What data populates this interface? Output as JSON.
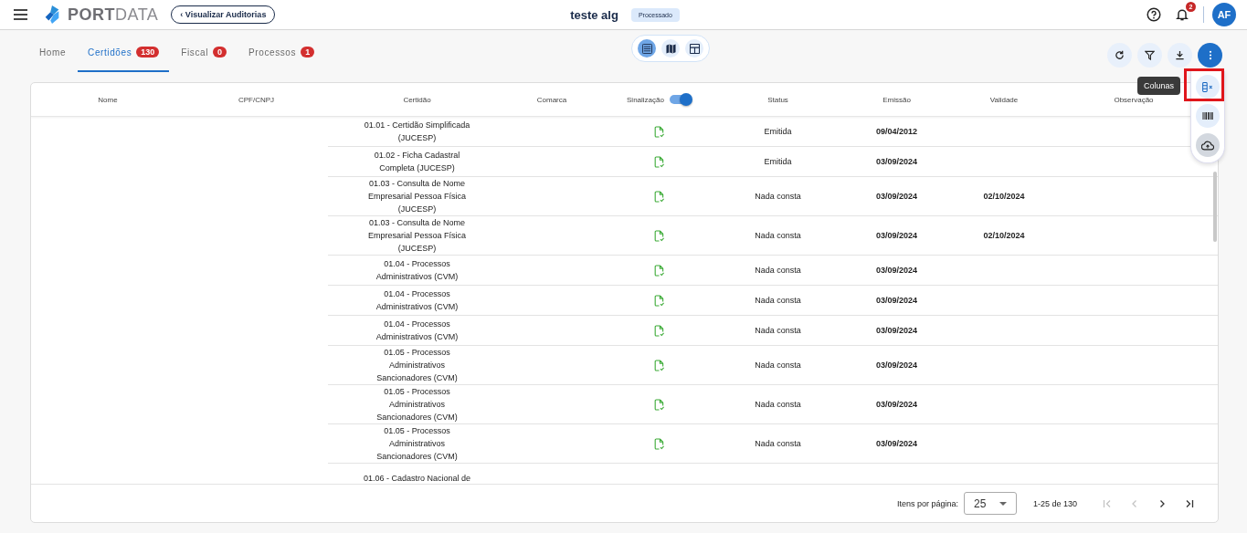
{
  "header": {
    "title": "teste alg",
    "status_badge": "Processado",
    "back_button": "Visualizar Auditorias",
    "back_chevron": "‹",
    "logo": {
      "part_1": "PORT",
      "part_2": "DATA"
    },
    "notifications": "2",
    "avatar": "AF"
  },
  "tabs": [
    {
      "label": "Home",
      "selected": false
    },
    {
      "label": "Certidões",
      "count": "130",
      "selected": true
    },
    {
      "label": "Fiscal",
      "count": "0",
      "selected": false
    },
    {
      "label": "Processos",
      "count": "1",
      "selected": false
    }
  ],
  "views": [
    {
      "kind": "list",
      "selected": true
    },
    {
      "kind": "map",
      "selected": false
    },
    {
      "kind": "table",
      "selected": false
    }
  ],
  "tooltip": "Colunas",
  "menu": [
    {
      "kind": "columns",
      "highlighted": true
    },
    {
      "kind": "barcode",
      "highlighted": false
    },
    {
      "kind": "upload",
      "highlighted": false
    }
  ],
  "table": {
    "columns": [
      "Nome",
      "CPF/CNPJ",
      "Certidão",
      "Comarca",
      "Sinalização",
      "Status",
      "Emissão",
      "Validade",
      "Observação"
    ],
    "signal_toggle": {
      "on": true
    },
    "rows": [
      {
        "certidao": "01.01 - Certidão Simplificada (JUCESP)",
        "status": "Emitida",
        "emissao": "09/04/2012"
      },
      {
        "certidao": "01.02 - Ficha Cadastral Completa (JUCESP)",
        "status": "Emitida",
        "emissao": "03/09/2024"
      },
      {
        "certidao": "01.03 - Consulta de Nome Empresarial Pessoa Física (JUCESP)",
        "status": "Nada consta",
        "emissao": "03/09/2024",
        "validade": "02/10/2024"
      },
      {
        "certidao": "01.03 - Consulta de Nome Empresarial Pessoa Física (JUCESP)",
        "status": "Nada consta",
        "emissao": "03/09/2024",
        "validade": "02/10/2024"
      },
      {
        "certidao": "01.04 - Processos Administrativos (CVM)",
        "status": "Nada consta",
        "emissao": "03/09/2024"
      },
      {
        "certidao": "01.04 - Processos Administrativos (CVM)",
        "status": "Nada consta",
        "emissao": "03/09/2024"
      },
      {
        "certidao": "01.04 - Processos Administrativos (CVM)",
        "status": "Nada consta",
        "emissao": "03/09/2024"
      },
      {
        "certidao": "01.05 - Processos Administrativos Sancionadores (CVM)",
        "status": "Nada consta",
        "emissao": "03/09/2024"
      },
      {
        "certidao": "01.05 - Processos Administrativos Sancionadores (CVM)",
        "status": "Nada consta",
        "emissao": "03/09/2024"
      },
      {
        "certidao": "01.05 - Processos Administrativos Sancionadores (CVM)",
        "status": "Nada consta",
        "emissao": "03/09/2024"
      },
      {
        "certidao": "01.06 - Cadastro Nacional de"
      }
    ]
  },
  "paginator": {
    "label": "Itens por página:",
    "page_size": "25",
    "range": "1-25 de 130",
    "first_disabled": true,
    "prev_disabled": true,
    "next_disabled": false,
    "last_disabled": false
  }
}
